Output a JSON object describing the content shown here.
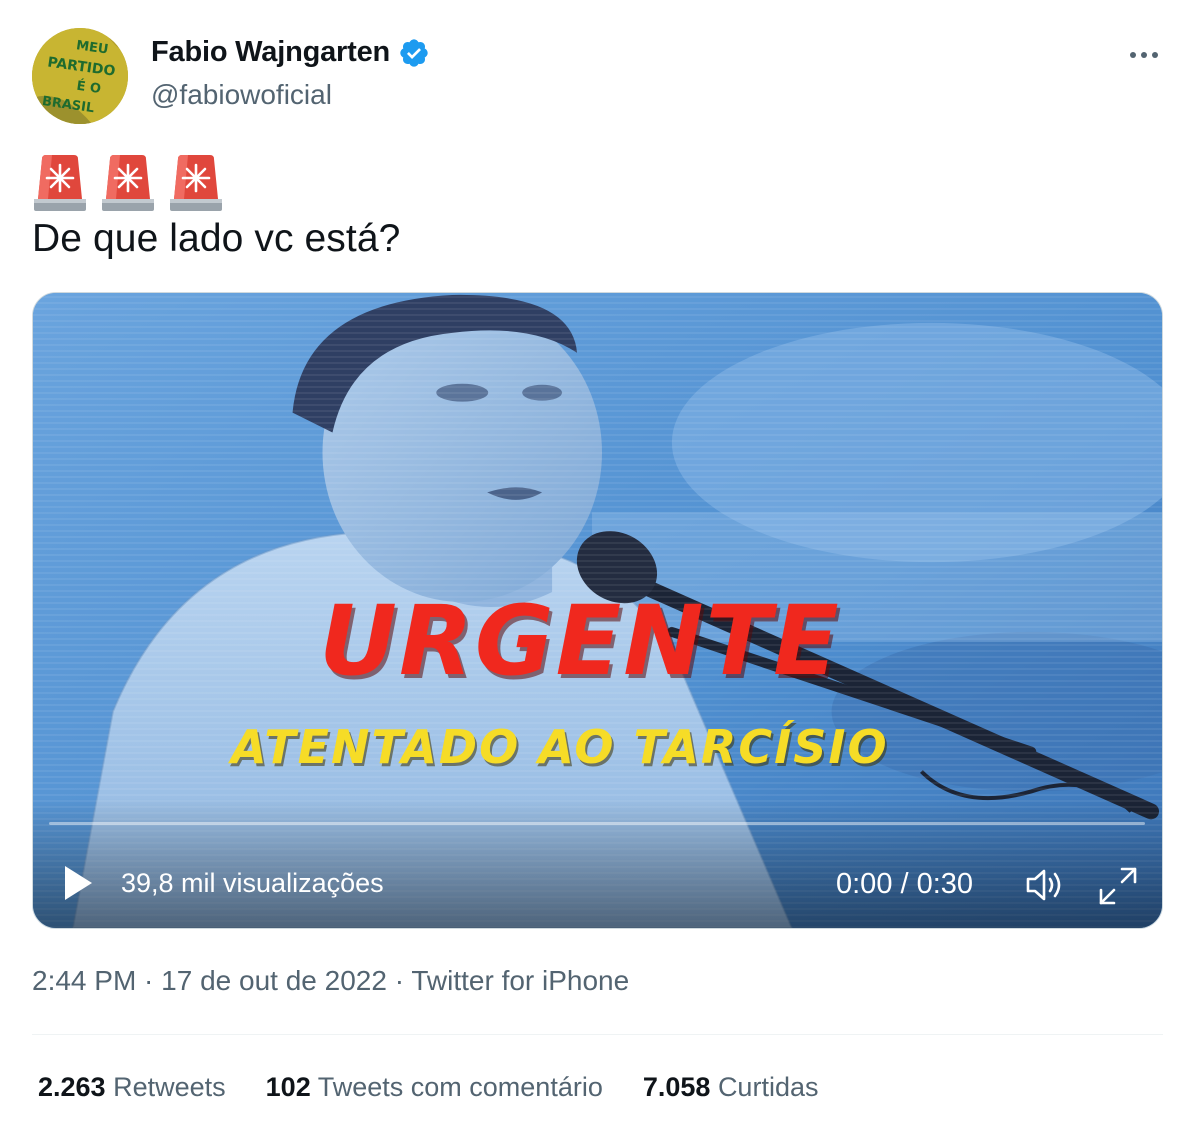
{
  "author": {
    "display_name": "Fabio Wajngarten",
    "handle": "@fabiowoficial",
    "verified_icon": "verified-badge-icon",
    "avatar_text": [
      "MEU",
      "PARTIDO",
      "É O",
      "BRASIL"
    ]
  },
  "tweet": {
    "emoji": [
      "🚨",
      "🚨",
      "🚨"
    ],
    "text": "De que lado vc está?"
  },
  "video": {
    "overlay_title": "URGENTE",
    "overlay_subtitle": "ATENTADO AO TARCÍSIO",
    "views": "39,8 mil visualizações",
    "time": "0:00 / 0:30",
    "progress": 0,
    "icons": [
      "play-icon",
      "volume-icon",
      "fullscreen-icon"
    ]
  },
  "meta": {
    "time": "2:44 PM",
    "date": "17 de out de 2022",
    "source": "Twitter for iPhone",
    "separator": " · "
  },
  "stats": [
    {
      "count": "2.263",
      "label": "Retweets"
    },
    {
      "count": "102",
      "label": "Tweets com comentário"
    },
    {
      "count": "7.058",
      "label": "Curtidas"
    }
  ],
  "colors": {
    "primary_text": "#0f1419",
    "secondary_text": "#536471",
    "verified_blue": "#1d9bf0",
    "urgent_red": "#f0281e",
    "subtitle_yellow": "#f6dc27"
  }
}
